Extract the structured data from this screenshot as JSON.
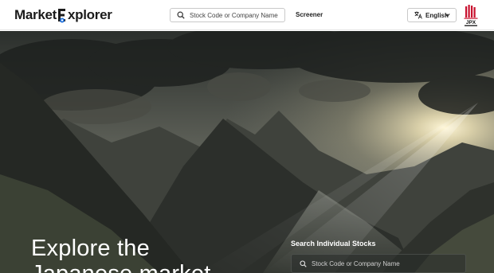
{
  "header": {
    "logo_text_a": "Market",
    "logo_text_b": "xplorer",
    "search": {
      "placeholder": "Stock Code or Company Name"
    },
    "screener_label": "Screener",
    "language": {
      "selected": "English"
    },
    "jpx_label": "JPX"
  },
  "hero": {
    "title_line1": "Explore the",
    "title_line2": "Japanese market",
    "individual_search": {
      "label": "Search Individual Stocks",
      "placeholder": "Stock Code or Company Name"
    }
  },
  "colors": {
    "brand_blue": "#1e6fd9",
    "jpx_red": "#c8102e",
    "header_bg": "#ffffff"
  },
  "icons": [
    "search-icon",
    "translate-icon",
    "chevron-down-icon",
    "location-pin-icon",
    "jpx-logo"
  ]
}
